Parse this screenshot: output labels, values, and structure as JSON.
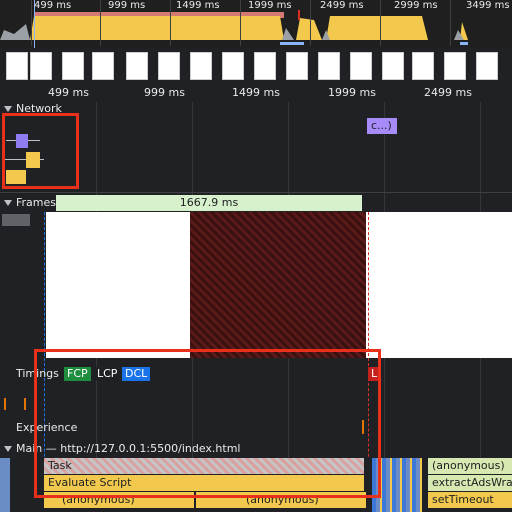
{
  "overview": {
    "ticks": [
      "499 ms",
      "999 ms",
      "1499 ms",
      "1999 ms",
      "2499 ms",
      "2999 ms",
      "3499 ms"
    ],
    "colors": {
      "script": "#f2c94c",
      "idle": "#9aa0a6",
      "selection": "#f28b82"
    }
  },
  "ruler": {
    "ticks": [
      "499 ms",
      "999 ms",
      "1499 ms",
      "1999 ms",
      "2499 ms"
    ]
  },
  "network": {
    "label": "Network",
    "request_label": "c...)"
  },
  "frames": {
    "label": "Frames",
    "duration": "1667.9 ms"
  },
  "timings": {
    "label": "Timings",
    "markers": [
      {
        "text": "FCP",
        "color": "#1e8e3e"
      },
      {
        "text": "LCP",
        "color": "#202124"
      },
      {
        "text": "DCL",
        "color": "#1a73e8"
      },
      {
        "text": "L",
        "color": "#c5221f"
      }
    ]
  },
  "experience": {
    "label": "Experience"
  },
  "main": {
    "label": "Main — http://127.0.0.1:5500/index.html",
    "task": "Task",
    "evaluate_script": "Evaluate Script",
    "anonymous": "(anonymous)",
    "extract": "extractAdsWrap",
    "set_timeout": "setTimeout"
  }
}
